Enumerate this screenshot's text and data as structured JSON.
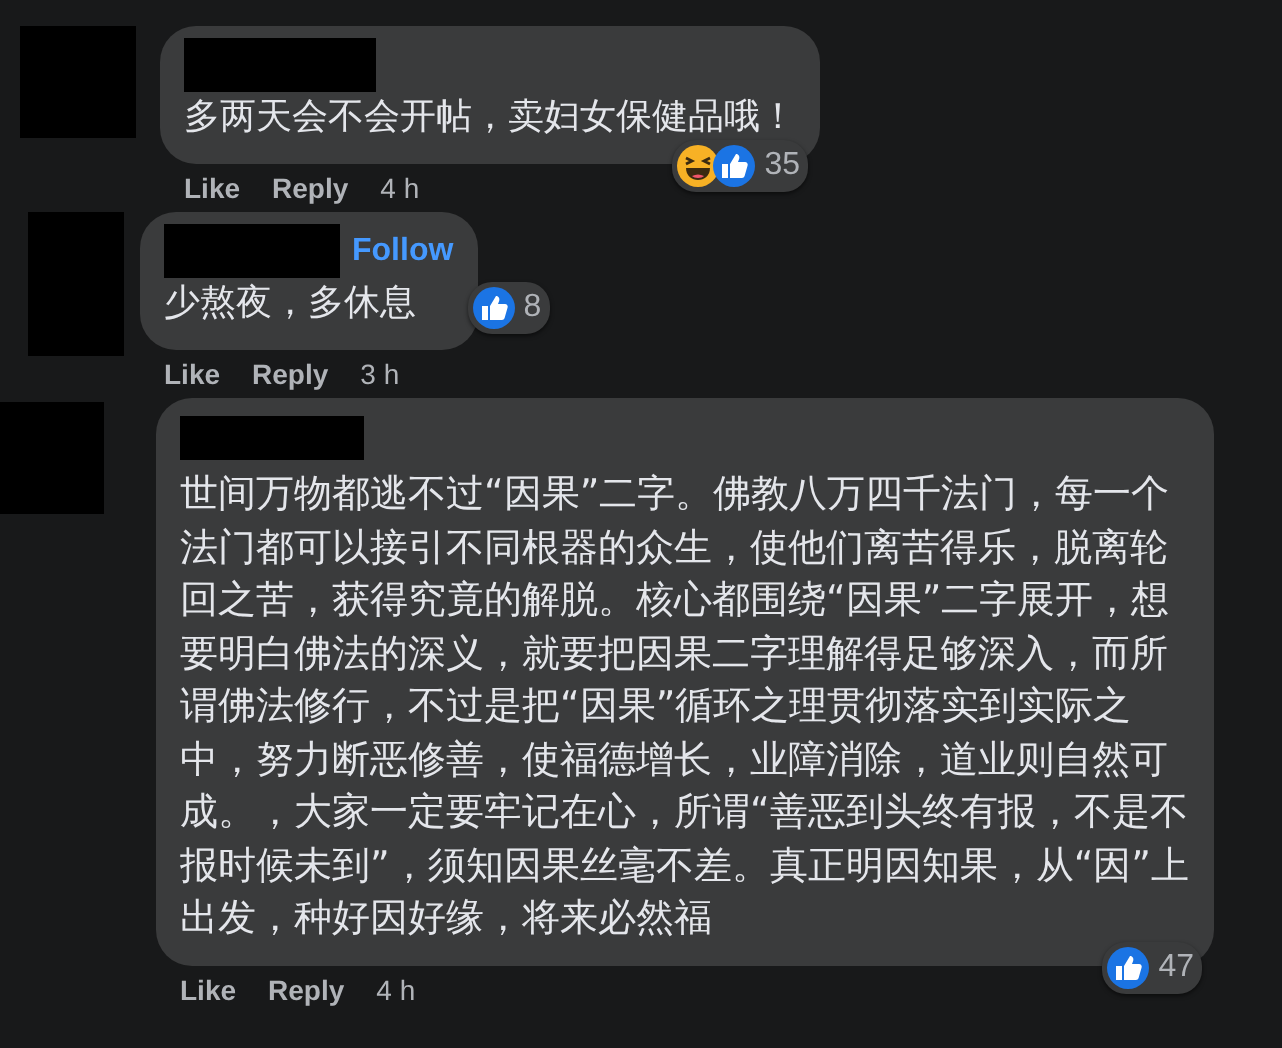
{
  "comments": [
    {
      "text": "多两天会不会开帖，卖妇女保健品哦！",
      "reactions": [
        {
          "kind": "haha"
        },
        {
          "kind": "like"
        }
      ],
      "reaction_count": "35",
      "actions": [
        "Like",
        "Reply"
      ],
      "time": "4 h"
    },
    {
      "follow": "Follow",
      "text": "少熬夜，多休息",
      "reactions": [
        {
          "kind": "like"
        }
      ],
      "reaction_count": "8",
      "actions": [
        "Like",
        "Reply"
      ],
      "time": "3 h"
    },
    {
      "text": "世间万物都逃不过“因果”二字。佛教八万四千法门，每一个法门都可以接引不同根器的众生，使他们离苦得乐，脱离轮回之苦，获得究竟的解脱。核心都围绕“因果”二字展开，想要明白佛法的深义，就要把因果二字理解得足够深入，而所谓佛法修行，不过是把“因果”循环之理贯彻落实到实际之中，努力断恶修善，使福德增长，业障消除，道业则自然可成。，大家一定要牢记在心，所谓“善恶到头终有报，不是不报时候未到”，须知因果丝毫不差。真正明因知果，从“因”上出发，种好因好缘，将来必然福",
      "reactions": [
        {
          "kind": "like"
        }
      ],
      "reaction_count": "47",
      "actions": [
        "Like",
        "Reply"
      ],
      "time": "4 h"
    }
  ]
}
